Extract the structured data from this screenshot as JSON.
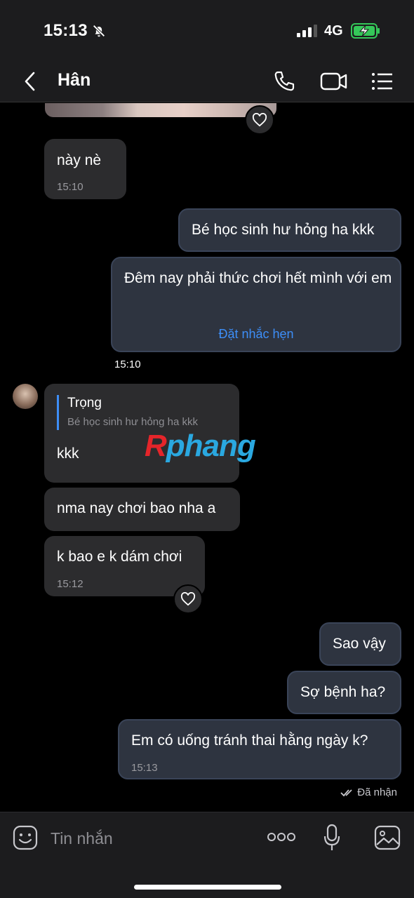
{
  "status_bar": {
    "time": "15:13",
    "network": "4G"
  },
  "header": {
    "contact_name": "Hân"
  },
  "messages": {
    "m1": {
      "text": "này nè",
      "time": "15:10"
    },
    "m2": {
      "text": "Bé học sinh hư hỏng ha kkk"
    },
    "m3": {
      "text": "Đêm nay phải thức chơi hết mình với em",
      "action": "Đặt nhắc hẹn",
      "time": "15:10"
    },
    "m4": {
      "reply_name": "Trọng",
      "reply_text": "Bé học sinh hư hỏng ha kkk",
      "text": "kkk"
    },
    "m5": {
      "text": "nma nay chơi bao nha a"
    },
    "m6": {
      "text": "k bao e k dám chơi",
      "time": "15:12"
    },
    "m7": {
      "text": "Sao vậy"
    },
    "m8": {
      "text": "Sợ bệnh ha?"
    },
    "m9": {
      "text": "Em có uống tránh thai hằng ngày k?",
      "time": "15:13"
    },
    "delivery_status": "Đã nhận"
  },
  "watermark": {
    "first": "R",
    "rest": "phang"
  },
  "input": {
    "placeholder": "Tin nhắn"
  },
  "colors": {
    "accent": "#3d8ef7",
    "incoming_bubble": "#2c2c2e",
    "outgoing_bubble": "#2e3440"
  }
}
